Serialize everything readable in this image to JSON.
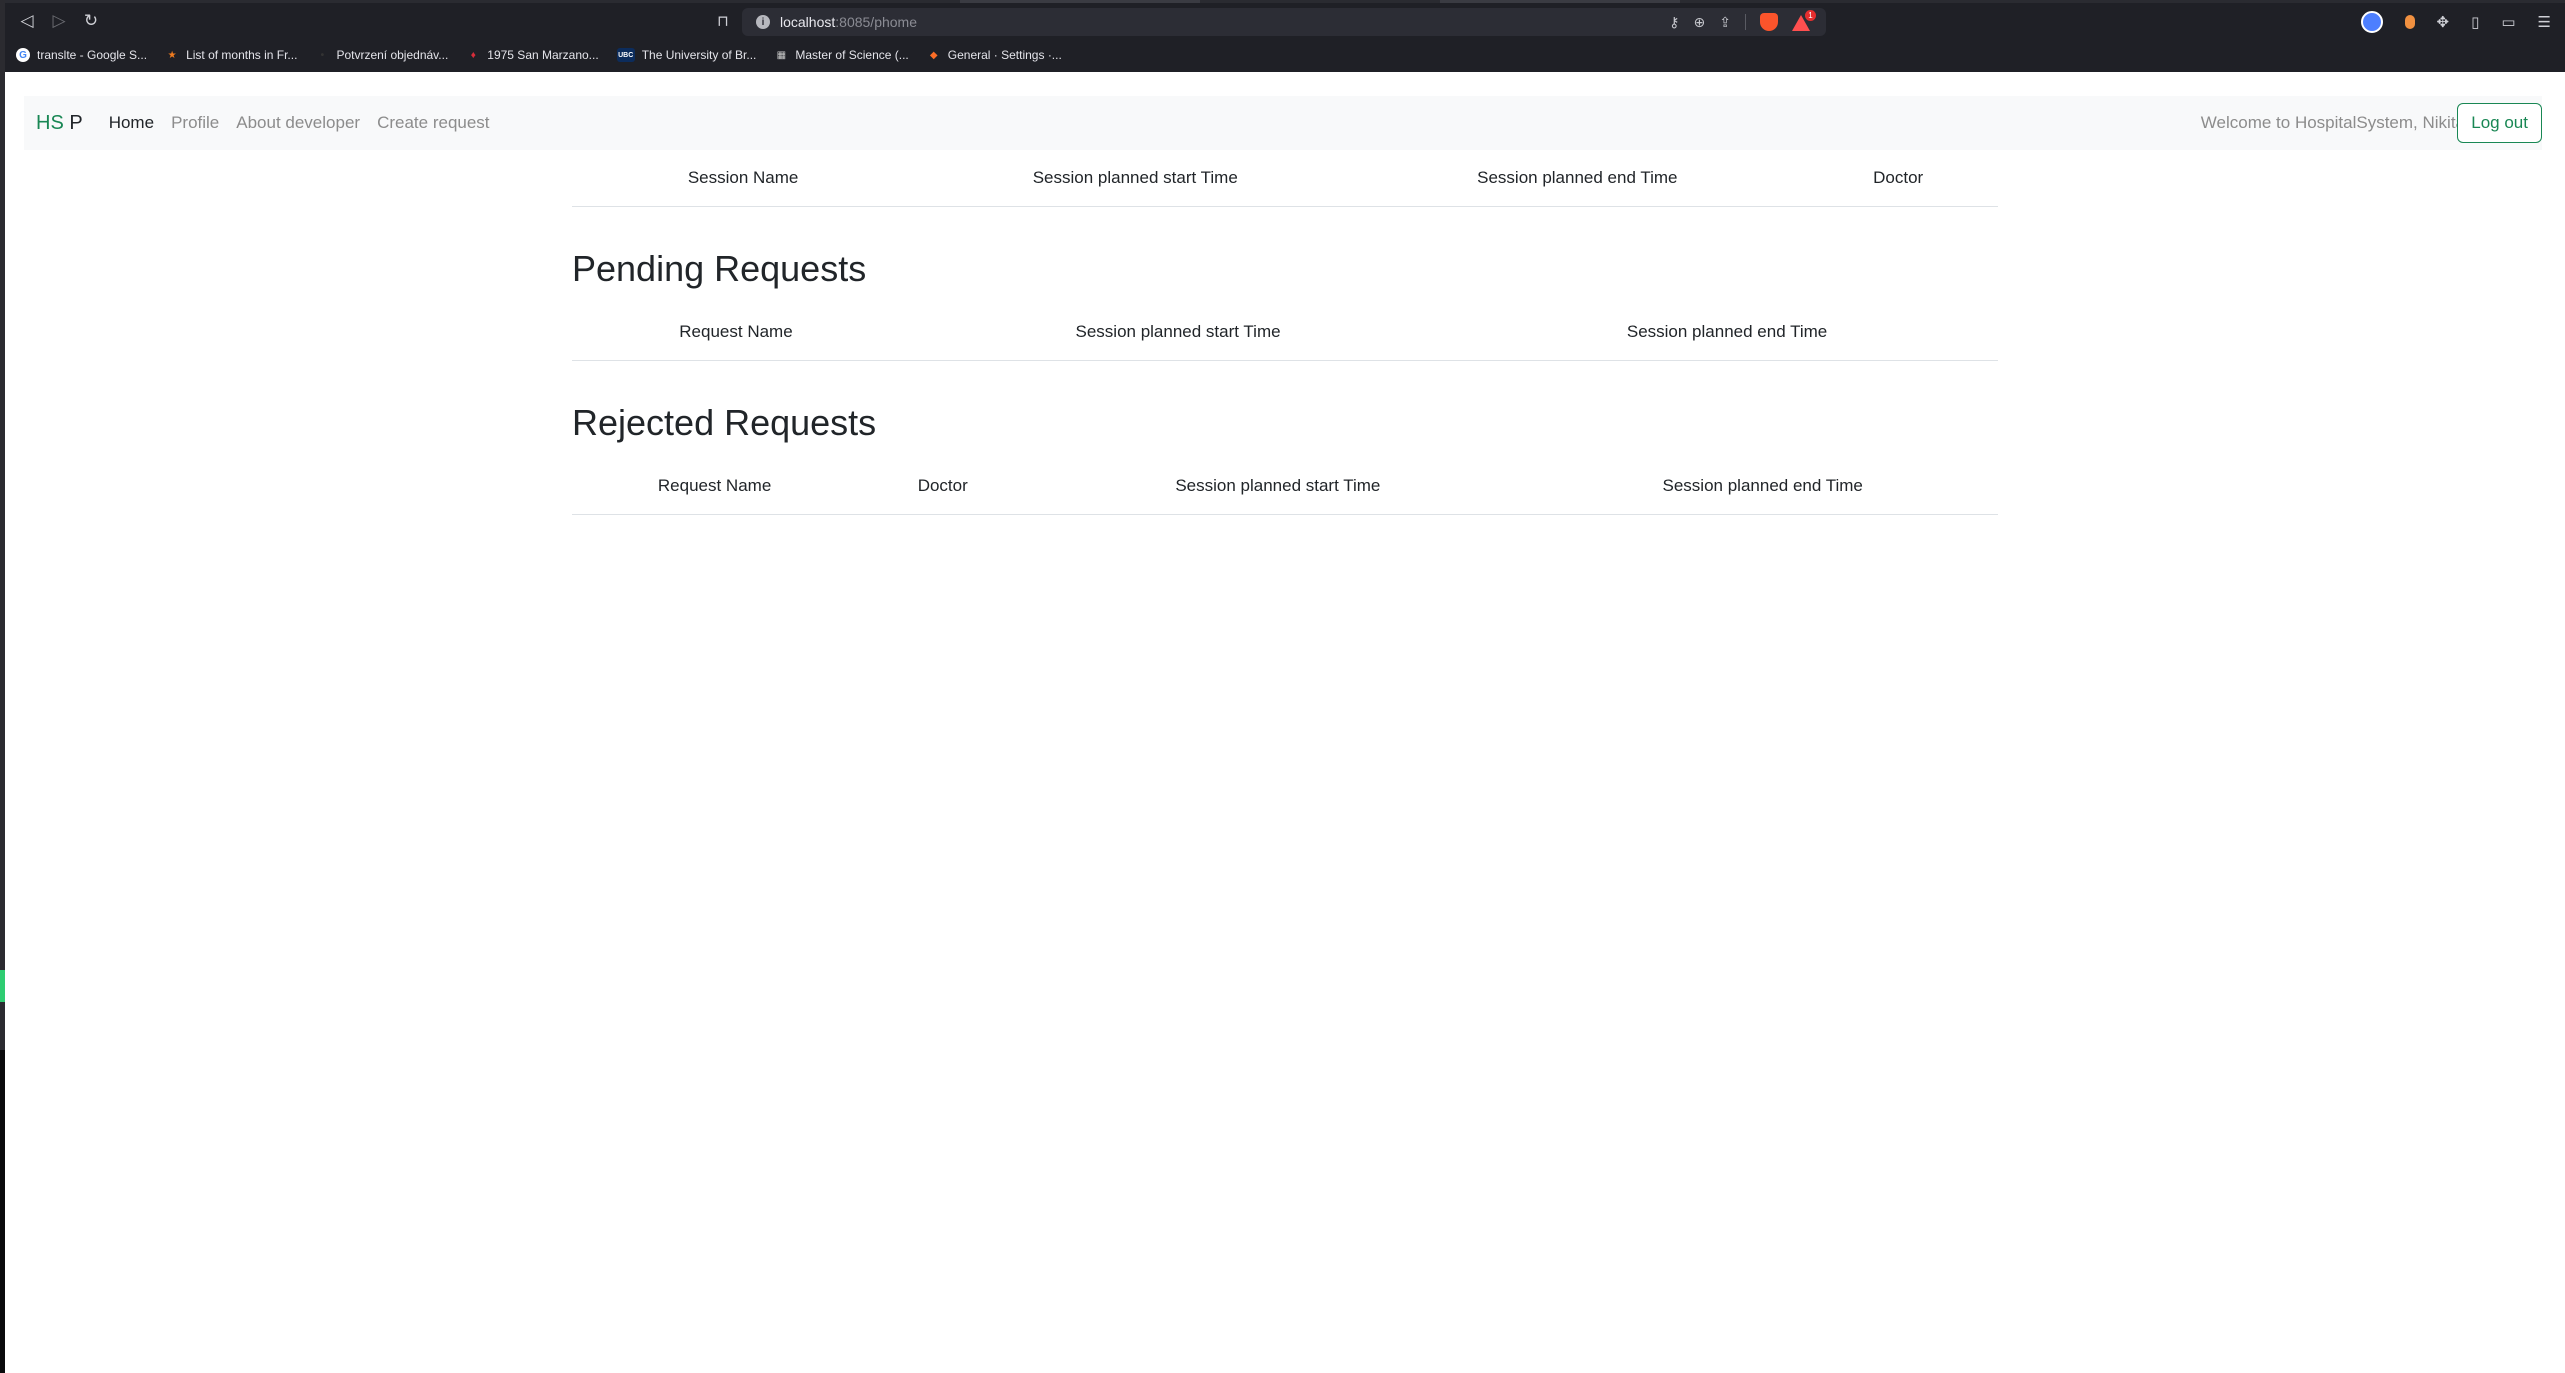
{
  "browser": {
    "url_host": "localhost",
    "url_path": ":8085/phome",
    "brave_badge": "1",
    "bookmarks": [
      {
        "label": "translte - Google S...",
        "icon": "google-icon",
        "icon_text": "G",
        "color": "#ffffff"
      },
      {
        "label": "List of months in Fr...",
        "icon": "star-icon",
        "icon_text": "★",
        "color": "#f07b1f"
      },
      {
        "label": "Potvrzení objednáv...",
        "icon": "bookmark-dot-icon",
        "icon_text": "•",
        "color": "#333333"
      },
      {
        "label": "1975 San Marzano...",
        "icon": "red-drop-icon",
        "icon_text": "♦",
        "color": "#d62d3a"
      },
      {
        "label": "The University of Br...",
        "icon": "ubc-icon",
        "icon_text": "UBC",
        "color": "#0c2c5c"
      },
      {
        "label": "Master of Science (...",
        "icon": "building-icon",
        "icon_text": "▦",
        "color": "#c9c9c9"
      },
      {
        "label": "General · Settings ·...",
        "icon": "gitlab-icon",
        "icon_text": "◆",
        "color": "#fc6d26"
      }
    ]
  },
  "navbar": {
    "brand_prefix": "HS",
    "brand_suffix": " P",
    "links": [
      "Home",
      "Profile",
      "About developer",
      "Create request"
    ],
    "welcome": "Welcome to HospitalSystem, Nikita",
    "logout": "Log out"
  },
  "sessions_table": {
    "headers": [
      "Session Name",
      "Session planned start Time",
      "Session planned end Time",
      "Doctor"
    ]
  },
  "pending": {
    "title": "Pending Requests",
    "headers": [
      "Request Name",
      "Session planned start Time",
      "Session planned end Time"
    ]
  },
  "rejected": {
    "title": "Rejected Requests",
    "headers": [
      "Request Name",
      "Doctor",
      "Session planned start Time",
      "Session planned end Time"
    ]
  },
  "colors": {
    "accent": "#198754",
    "navbar_bg": "#f8f9fa",
    "chrome_bg": "#1f2026"
  }
}
